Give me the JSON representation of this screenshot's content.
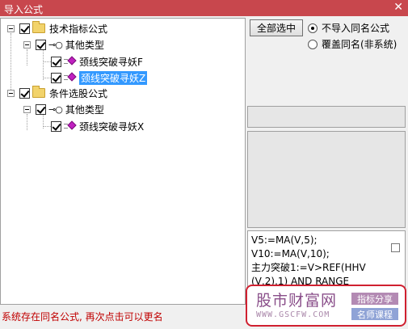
{
  "window": {
    "title": "导入公式",
    "close_glyph": "✕"
  },
  "tree": {
    "nodes": [
      {
        "label": "技术指标公式",
        "kind": "folder"
      },
      {
        "label": "其他类型",
        "kind": "type"
      },
      {
        "label": "颈线突破寻妖F",
        "kind": "formula",
        "selected": false
      },
      {
        "label": "颈线突破寻妖Z",
        "kind": "formula",
        "selected": true
      },
      {
        "label": "条件选股公式",
        "kind": "folder"
      },
      {
        "label": "其他类型",
        "kind": "type"
      },
      {
        "label": "颈线突破寻妖X",
        "kind": "formula",
        "selected": false
      }
    ]
  },
  "buttons": {
    "select_all": "全部选中"
  },
  "options": {
    "no_import": "不导入同名公式",
    "overwrite": "覆盖同名(非系统)",
    "selected": "no_import"
  },
  "code": {
    "lines": [
      "V5:=MA(V,5);",
      "V10:=MA(V,10);",
      "主力突破1:=V>REF(HHV",
      "(V,2),1) AND RANGE"
    ]
  },
  "watermark": {
    "title": "股市财富网",
    "url": "WWW.GSCFW.COM",
    "tag1": "指标分享",
    "tag2": "名师课程"
  },
  "status": "系统存在同名公式, 再次点击可以更名",
  "colors": {
    "titlebar": "#c8474d",
    "selection": "#3399ff",
    "status": "#c00000"
  }
}
